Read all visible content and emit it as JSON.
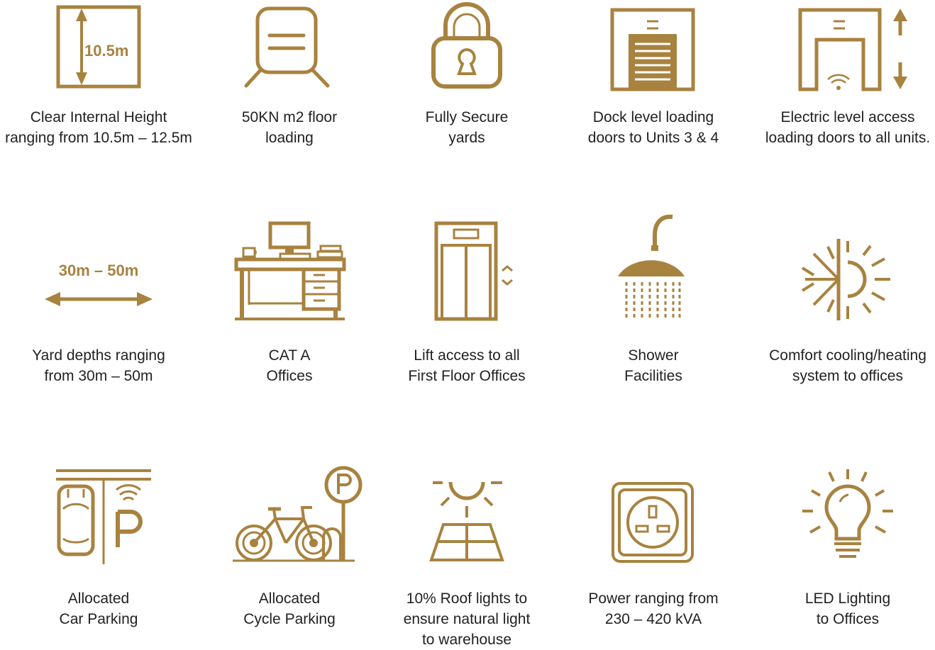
{
  "colors": {
    "accent": "#a8823f",
    "text": "#222222",
    "background": "#ffffff"
  },
  "features": [
    {
      "icon": "ceiling-height-icon",
      "icon_text": "10.5m",
      "lines": [
        "Clear Internal Height",
        "ranging from 10.5m – 12.5m"
      ]
    },
    {
      "icon": "floor-loading-icon",
      "lines": [
        "50KN m2 floor",
        "loading"
      ]
    },
    {
      "icon": "padlock-icon",
      "lines": [
        "Fully Secure",
        "yards"
      ]
    },
    {
      "icon": "dock-door-icon",
      "lines": [
        "Dock level loading",
        "doors to Units 3 & 4"
      ]
    },
    {
      "icon": "electric-door-icon",
      "lines": [
        "Electric level access",
        "loading doors to all units."
      ]
    },
    {
      "icon": "yard-depth-arrow-icon",
      "icon_text": "30m – 50m",
      "lines": [
        "Yard depths ranging",
        "from 30m – 50m"
      ]
    },
    {
      "icon": "office-desk-icon",
      "lines": [
        "CAT A",
        "Offices"
      ]
    },
    {
      "icon": "lift-icon",
      "lines": [
        "Lift access to all",
        "First Floor Offices"
      ]
    },
    {
      "icon": "shower-icon",
      "lines": [
        "Shower",
        "Facilities"
      ]
    },
    {
      "icon": "heating-cooling-icon",
      "lines": [
        "Comfort cooling/heating",
        "system to offices"
      ]
    },
    {
      "icon": "car-parking-icon",
      "icon_text": "P",
      "lines": [
        "Allocated",
        "Car Parking"
      ]
    },
    {
      "icon": "cycle-parking-icon",
      "icon_text": "P",
      "lines": [
        "Allocated",
        "Cycle Parking"
      ]
    },
    {
      "icon": "roof-light-icon",
      "lines": [
        "10% Roof lights to",
        "ensure natural light",
        "to warehouse"
      ]
    },
    {
      "icon": "power-socket-icon",
      "lines": [
        "Power ranging from",
        "230 – 420   kVA"
      ]
    },
    {
      "icon": "light-bulb-icon",
      "lines": [
        "LED Lighting",
        "to Offices"
      ]
    }
  ]
}
